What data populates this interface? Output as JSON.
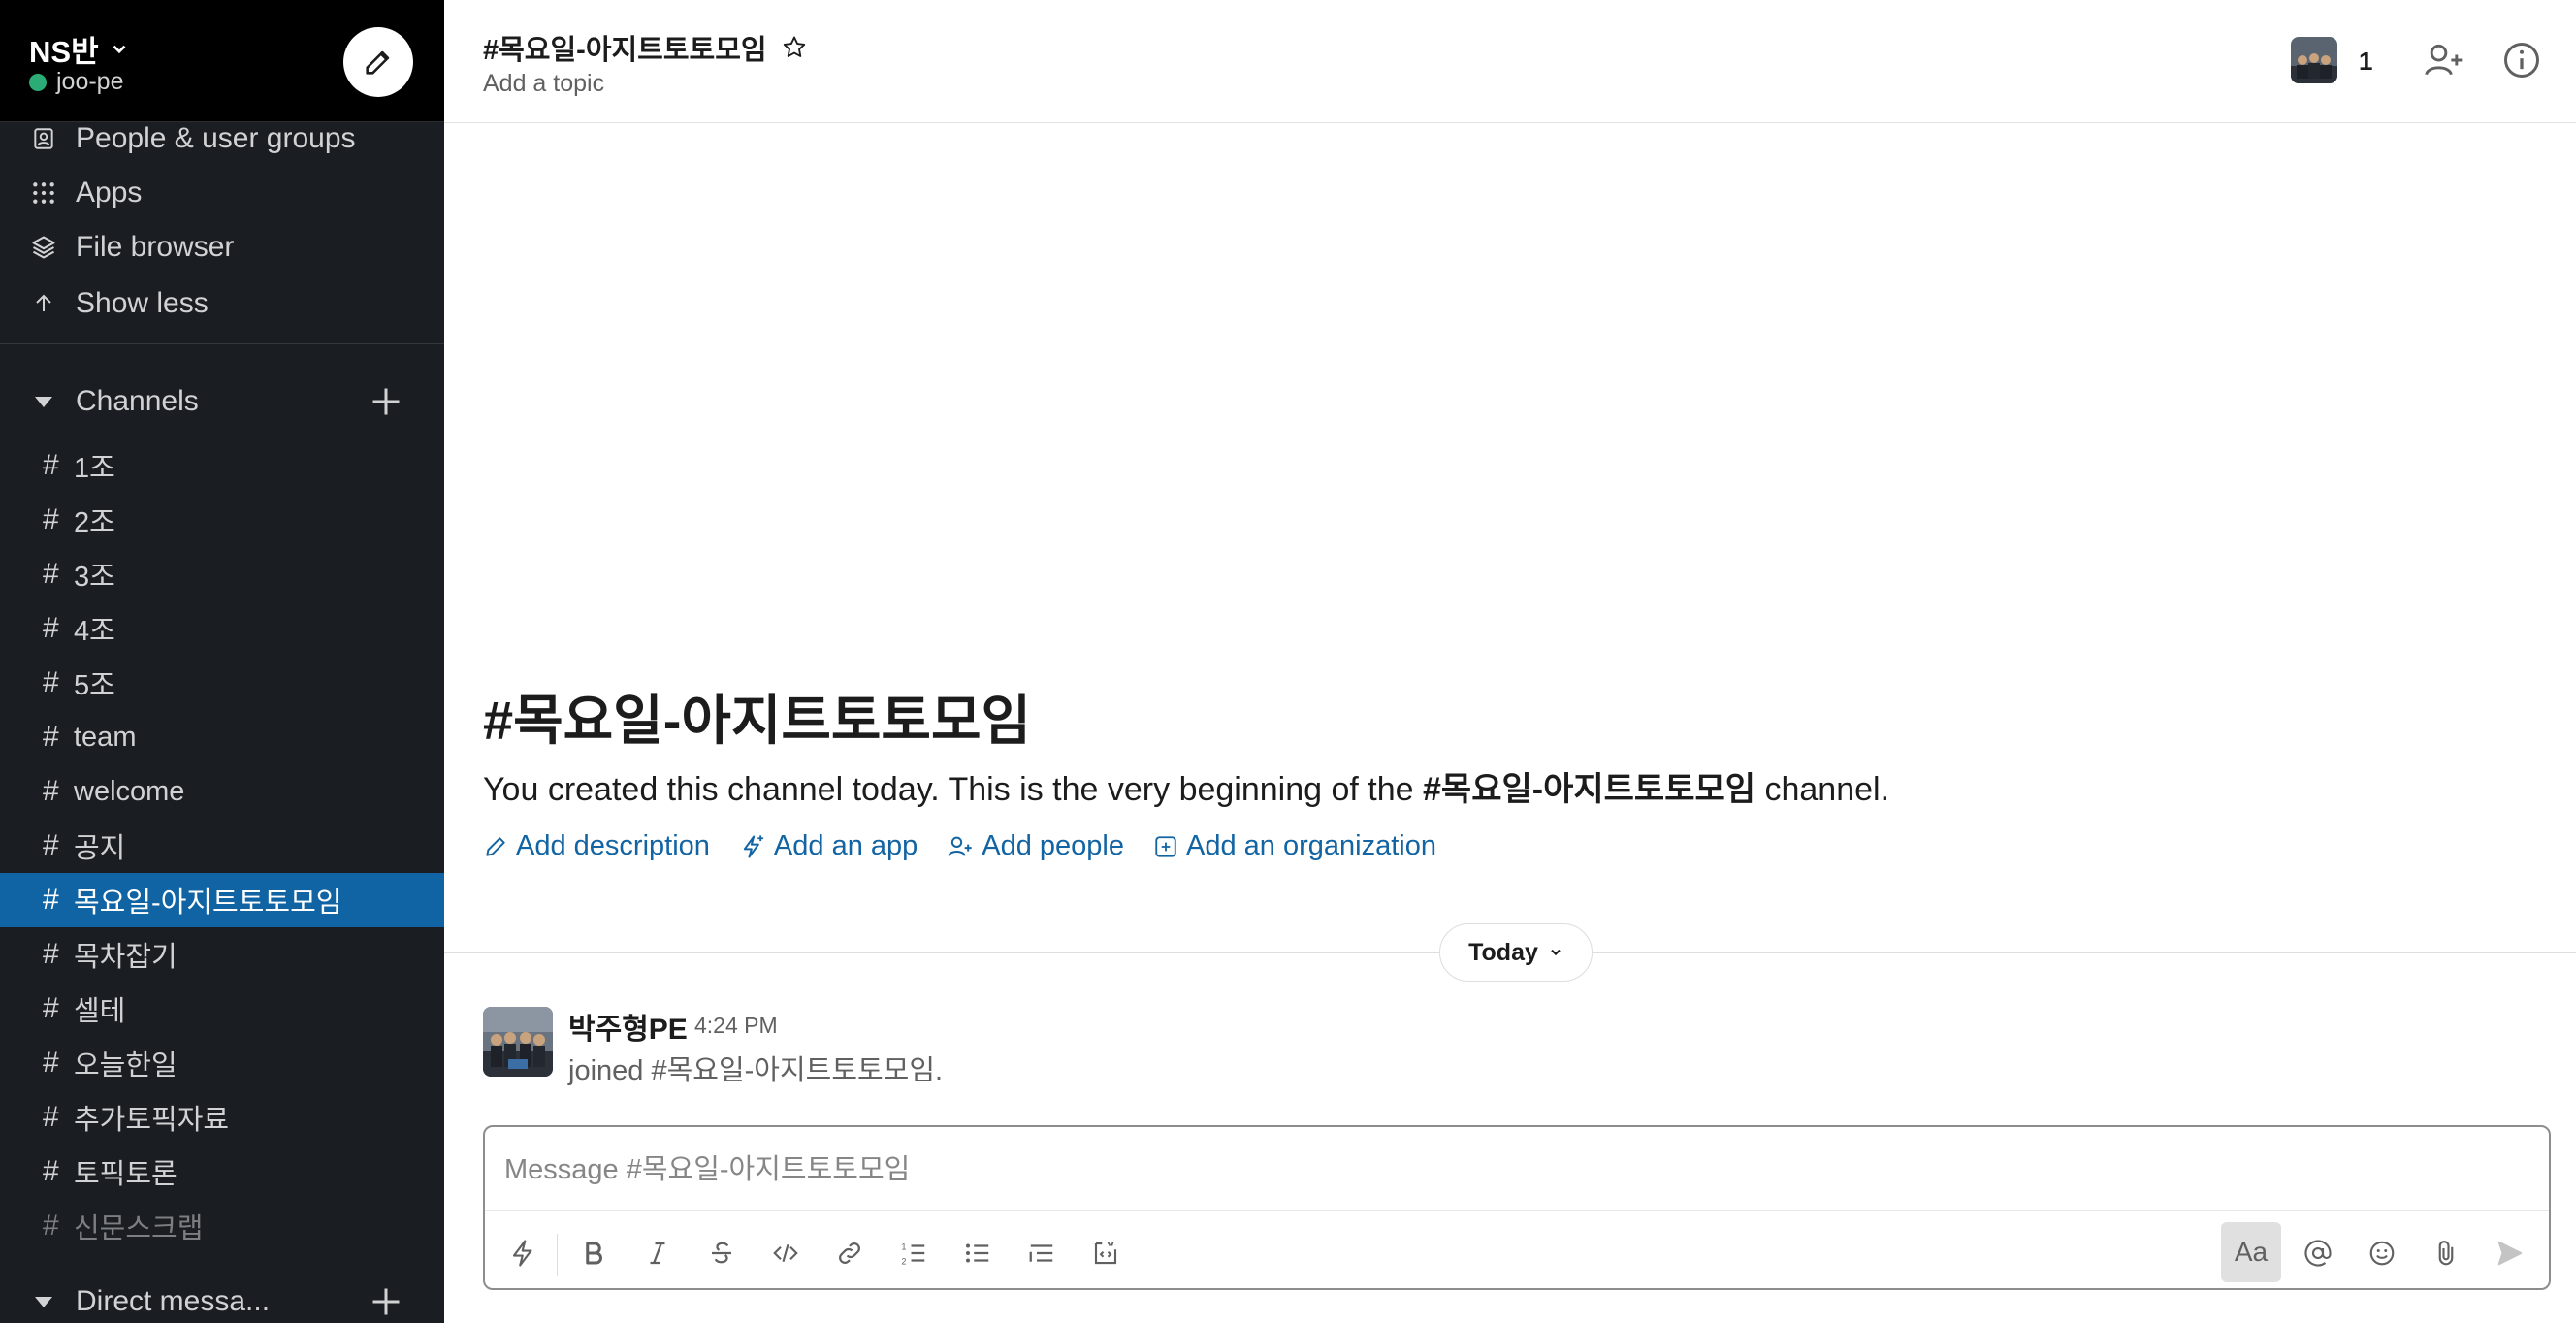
{
  "workspace": {
    "name": "NS반",
    "user": "joo-pe"
  },
  "nav": [
    {
      "label": "People & user groups",
      "icon": "contact-card-icon"
    },
    {
      "label": "Apps",
      "icon": "apps-grid-icon"
    },
    {
      "label": "File browser",
      "icon": "layers-icon"
    },
    {
      "label": "Show less",
      "icon": "arrow-up-icon"
    }
  ],
  "channels_section": {
    "label": "Channels"
  },
  "channels": [
    {
      "name": "1조"
    },
    {
      "name": "2조"
    },
    {
      "name": "3조"
    },
    {
      "name": "4조"
    },
    {
      "name": "5조"
    },
    {
      "name": "team"
    },
    {
      "name": "welcome"
    },
    {
      "name": "공지"
    },
    {
      "name": "목요일-아지트토토모임",
      "active": true
    },
    {
      "name": "목차잡기"
    },
    {
      "name": "셀테"
    },
    {
      "name": "오늘한일"
    },
    {
      "name": "추가토픽자료"
    },
    {
      "name": "토픽토론"
    },
    {
      "name": "신문스크랩",
      "muted": true
    }
  ],
  "dm_section": {
    "label": "Direct messa..."
  },
  "header": {
    "title": "#목요일-아지트토토모임",
    "topic": "Add a topic",
    "member_count": "1"
  },
  "intro": {
    "title": "#목요일-아지트토토모임",
    "text_before": "You created this channel today. This is the very beginning of the ",
    "channel_bold": "#목요일-아지트토토모임",
    "text_after": " channel.",
    "actions": [
      "Add description",
      "Add an app",
      "Add people",
      "Add an organization"
    ]
  },
  "divider": {
    "label": "Today"
  },
  "message": {
    "author": "박주형PE",
    "time": "4:24 PM",
    "body": "joined #목요일-아지트토토모임."
  },
  "composer": {
    "placeholder": "Message #목요일-아지트토토모임",
    "format_label": "Aa"
  },
  "colors": {
    "sidebar": "#1a1d21",
    "active": "#1164a3",
    "link": "#1264a3",
    "status": "#2bac76"
  }
}
